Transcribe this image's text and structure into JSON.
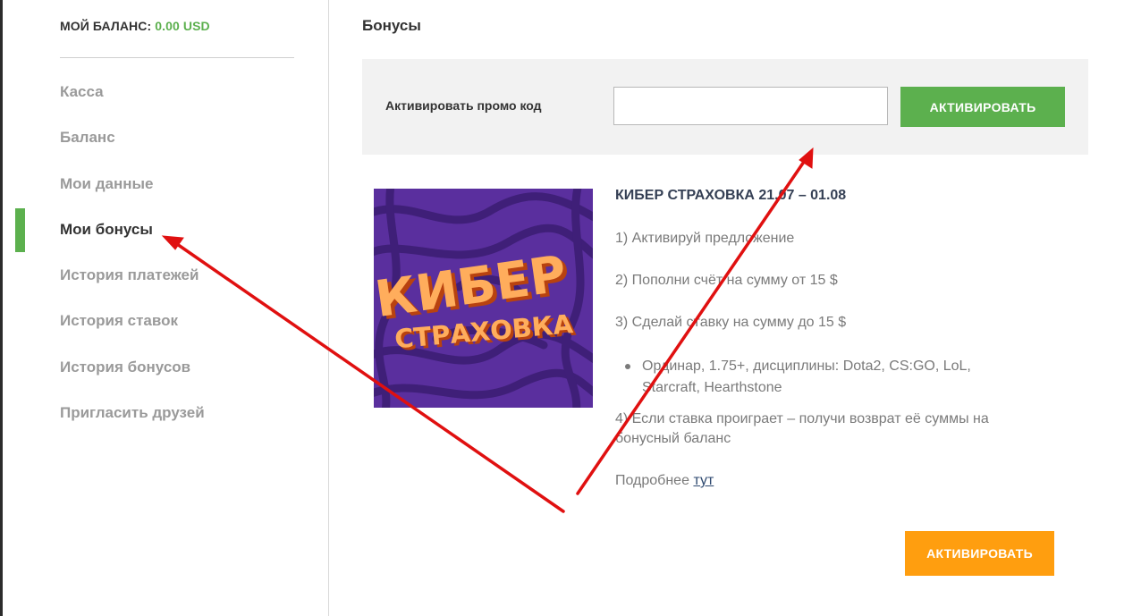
{
  "sidebar": {
    "balance_label": "МОЙ БАЛАНС:",
    "balance_amount": "0.00 USD",
    "items": [
      {
        "label": "Касса",
        "active": false
      },
      {
        "label": "Баланс",
        "active": false
      },
      {
        "label": "Мои данные",
        "active": false
      },
      {
        "label": "Мои бонусы",
        "active": true
      },
      {
        "label": "История платежей",
        "active": false
      },
      {
        "label": "История ставок",
        "active": false
      },
      {
        "label": "История бонусов",
        "active": false
      },
      {
        "label": "Пригласить друзей",
        "active": false
      }
    ]
  },
  "main": {
    "title": "Бонусы",
    "promo": {
      "label": "Активировать промо код",
      "input_value": "",
      "button_label": "АКТИВИРОВАТЬ"
    },
    "bonus": {
      "image_text_top": "КИБЕР",
      "image_text_bottom": "СТРАХОВКА",
      "title": "КИБЕР СТРАХОВКА 21.07 – 01.08",
      "step1": "1) Активируй предложение",
      "step2": "2) Пополни счёт на сумму от 15 $",
      "step3": "3) Сделай ставку на сумму до 15 $",
      "bullet": "Ординар, 1.75+, дисциплины: Dota2, CS:GO, LoL, Starcraft,  Hearthstone",
      "step4": "4) Если ставка проиграет – получи возврат её суммы на бонусный баланс",
      "more_prefix": "Подробнее",
      "more_link": "тут",
      "button_label": "АКТИВИРОВАТЬ"
    }
  },
  "colors": {
    "accent_green": "#5cb04e",
    "accent_orange": "#ff9e0f",
    "annotation_red": "#e01010",
    "image_purple": "#5a2f9e"
  }
}
